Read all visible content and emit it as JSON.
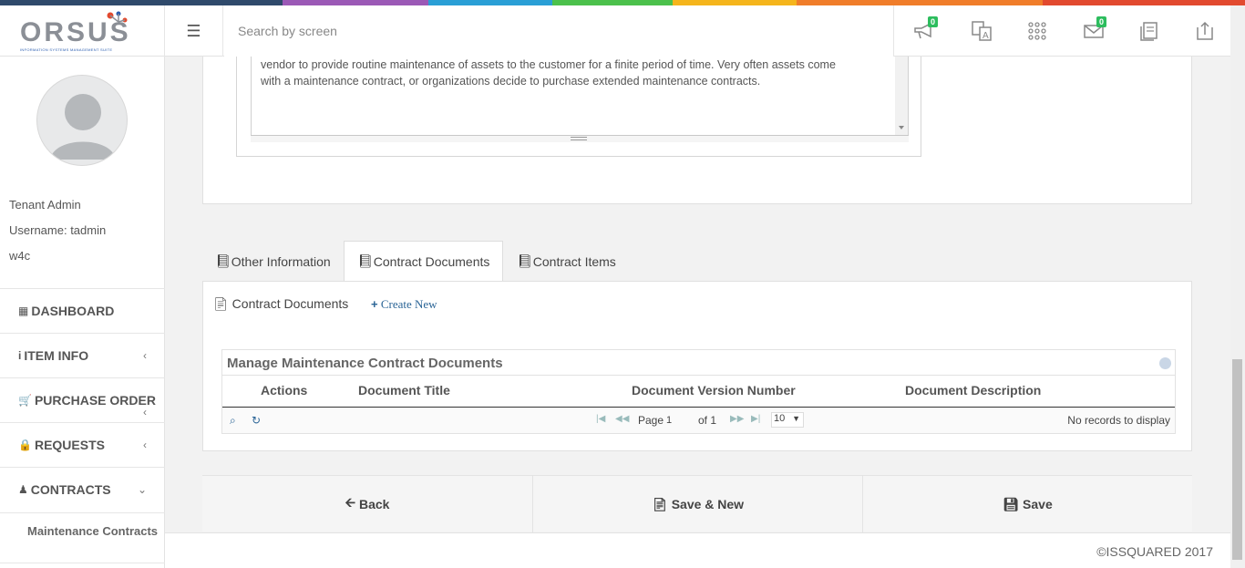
{
  "header": {
    "logo_text": "ORSUS",
    "logo_subtitle": "INFORMATION SYSTEMS MANAGEMENT SUITE",
    "search_placeholder": "Search by screen",
    "announcements_badge": "0",
    "messages_badge": "0",
    "rainbow_colors": [
      "#2f4a6b",
      "#9b59b6",
      "#2a9fd6",
      "#4cc14c",
      "#f5b51c",
      "#f07d2a",
      "#e24a2f"
    ]
  },
  "user": {
    "role": "Tenant Admin",
    "username": "Username: tadmin",
    "tenant": "w4c"
  },
  "sidebar": {
    "items": [
      {
        "label": "DASHBOARD",
        "icon": "grid-icon"
      },
      {
        "label": "ITEM INFO",
        "icon": "info-icon"
      },
      {
        "label": "PURCHASE ORDER",
        "icon": "cart-icon"
      },
      {
        "label": "REQUESTS",
        "icon": "lock-icon"
      },
      {
        "label": "CONTRACTS",
        "icon": "user-icon"
      }
    ],
    "sub_item": "Maintenance Contracts"
  },
  "description": {
    "line1": "vendor to provide routine maintenance of assets to the customer for a finite period of time. Very often assets come",
    "line2": "with a maintenance contract, or organizations decide to purchase extended maintenance contracts."
  },
  "tabs": [
    {
      "label": "Other Information"
    },
    {
      "label": "Contract Documents"
    },
    {
      "label": "Contract Items"
    }
  ],
  "docs": {
    "title": "Contract Documents",
    "create_new": "Create New",
    "grid_caption": "Manage Maintenance Contract Documents",
    "columns": [
      "Actions",
      "Document Title",
      "Document Version Number",
      "Document Description"
    ],
    "page_label": "Page",
    "page_value": "1",
    "page_of": "of 1",
    "page_size": "10",
    "no_records": "No records to display"
  },
  "buttons": {
    "back": "Back",
    "save_new": "Save & New",
    "save": "Save"
  },
  "footer": "©ISSQUARED 2017"
}
